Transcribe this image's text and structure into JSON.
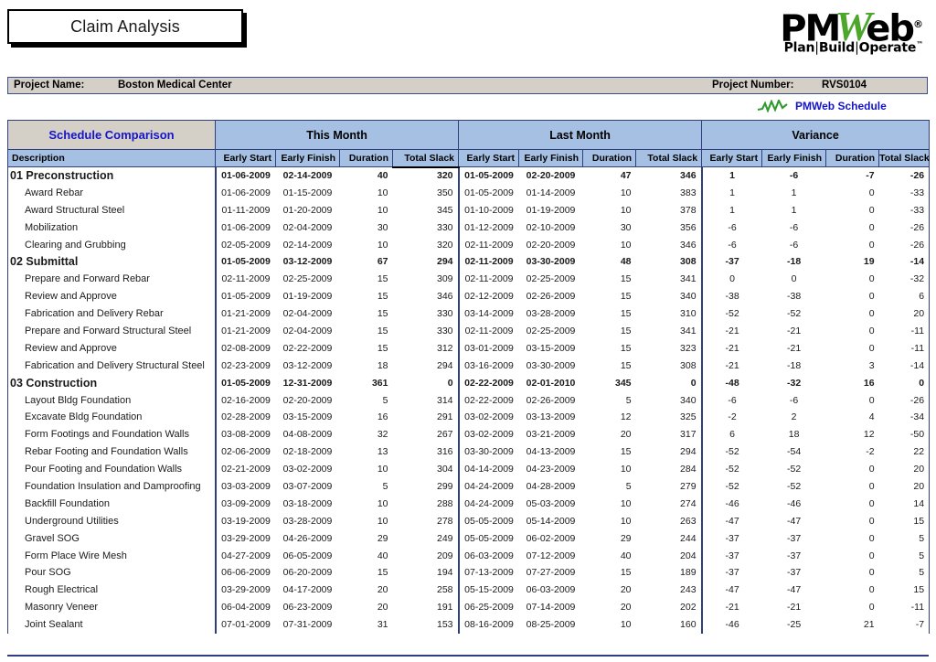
{
  "report": {
    "title": "Claim Analysis",
    "logo": {
      "part1": "PM",
      "part2": "W",
      "part3": "eb",
      "registered": "®",
      "tagline_plan": "Plan",
      "tagline_build": "Build",
      "tagline_operate": "Operate",
      "tagline_sep": "|",
      "tm": "™"
    },
    "project": {
      "name_label": "Project Name:",
      "name_value": "Boston Medical Center",
      "number_label": "Project Number:",
      "number_value": "RVS0104"
    },
    "legend": {
      "icon": "zigzag-schedule-icon",
      "label": "PMWeb Schedule"
    }
  },
  "colors": {
    "header_blue": "#A5C0E3",
    "header_gray": "#D4D0C8",
    "border_navy": "#2E3F7F",
    "link_blue": "#1414CC",
    "accent_green": "#4CA72C",
    "negative_red": "#E8221B"
  },
  "table": {
    "group_headers": [
      "Schedule Comparison",
      "This Month",
      "Last Month",
      "Variance"
    ],
    "columns": [
      "Description",
      "Early Start",
      "Early Finish",
      "Duration",
      "Total Slack",
      "Early Start",
      "Early Finish",
      "Duration",
      "Total Slack",
      "Early Start",
      "Early Finish",
      "Duration",
      "Total Slack"
    ],
    "rows": [
      {
        "level": 0,
        "desc": "01 Preconstruction",
        "tm": [
          "01-06-2009",
          "02-14-2009",
          "40",
          "320"
        ],
        "lm": [
          "01-05-2009",
          "02-20-2009",
          "47",
          "346"
        ],
        "va": [
          "1",
          "-6",
          "-7",
          "-26"
        ],
        "red": []
      },
      {
        "level": 1,
        "desc": "Award Rebar",
        "tm": [
          "01-06-2009",
          "01-15-2009",
          "10",
          "350"
        ],
        "lm": [
          "01-05-2009",
          "01-14-2009",
          "10",
          "383"
        ],
        "va": [
          "1",
          "1",
          "0",
          "-33"
        ],
        "red": []
      },
      {
        "level": 1,
        "desc": "Award Structural Steel",
        "tm": [
          "01-11-2009",
          "01-20-2009",
          "10",
          "345"
        ],
        "lm": [
          "01-10-2009",
          "01-19-2009",
          "10",
          "378"
        ],
        "va": [
          "1",
          "1",
          "0",
          "-33"
        ],
        "red": []
      },
      {
        "level": 1,
        "desc": "Mobilization",
        "tm": [
          "01-06-2009",
          "02-04-2009",
          "30",
          "330"
        ],
        "lm": [
          "01-12-2009",
          "02-10-2009",
          "30",
          "356"
        ],
        "va": [
          "-6",
          "-6",
          "0",
          "-26"
        ],
        "red": []
      },
      {
        "level": 1,
        "desc": "Clearing and Grubbing",
        "tm": [
          "02-05-2009",
          "02-14-2009",
          "10",
          "320"
        ],
        "lm": [
          "02-11-2009",
          "02-20-2009",
          "10",
          "346"
        ],
        "va": [
          "-6",
          "-6",
          "0",
          "-26"
        ],
        "red": []
      },
      {
        "level": 0,
        "desc": "02 Submittal",
        "tm": [
          "01-05-2009",
          "03-12-2009",
          "67",
          "294"
        ],
        "lm": [
          "02-11-2009",
          "03-30-2009",
          "48",
          "308"
        ],
        "va": [
          "-37",
          "-18",
          "19",
          "-14"
        ],
        "red": []
      },
      {
        "level": 1,
        "desc": "Prepare and Forward Rebar",
        "tm": [
          "02-11-2009",
          "02-25-2009",
          "15",
          "309"
        ],
        "lm": [
          "02-11-2009",
          "02-25-2009",
          "15",
          "341"
        ],
        "va": [
          "0",
          "0",
          "0",
          "-32"
        ],
        "red": []
      },
      {
        "level": 1,
        "desc": "Review and Approve",
        "tm": [
          "01-05-2009",
          "01-19-2009",
          "15",
          "346"
        ],
        "lm": [
          "02-12-2009",
          "02-26-2009",
          "15",
          "340"
        ],
        "va": [
          "-38",
          "-38",
          "0",
          "6"
        ],
        "red": []
      },
      {
        "level": 1,
        "desc": "Fabrication and Delivery Rebar",
        "tm": [
          "01-21-2009",
          "02-04-2009",
          "15",
          "330"
        ],
        "lm": [
          "03-14-2009",
          "03-28-2009",
          "15",
          "310"
        ],
        "va": [
          "-52",
          "-52",
          "0",
          "20"
        ],
        "red": []
      },
      {
        "level": 1,
        "desc": "Prepare and Forward Structural Steel",
        "tm": [
          "01-21-2009",
          "02-04-2009",
          "15",
          "330"
        ],
        "lm": [
          "02-11-2009",
          "02-25-2009",
          "15",
          "341"
        ],
        "va": [
          "-21",
          "-21",
          "0",
          "-11"
        ],
        "red": []
      },
      {
        "level": 1,
        "desc": "Review and Approve",
        "tm": [
          "02-08-2009",
          "02-22-2009",
          "15",
          "312"
        ],
        "lm": [
          "03-01-2009",
          "03-15-2009",
          "15",
          "323"
        ],
        "va": [
          "-21",
          "-21",
          "0",
          "-11"
        ],
        "red": []
      },
      {
        "level": 1,
        "desc": "Fabrication and Delivery Structural Steel",
        "tm": [
          "02-23-2009",
          "03-12-2009",
          "18",
          "294"
        ],
        "lm": [
          "03-16-2009",
          "03-30-2009",
          "15",
          "308"
        ],
        "va": [
          "-21",
          "-18",
          "3",
          "-14"
        ],
        "red": []
      },
      {
        "level": 0,
        "desc": "03 Construction",
        "tm": [
          "01-05-2009",
          "12-31-2009",
          "361",
          "0"
        ],
        "lm": [
          "02-22-2009",
          "02-01-2010",
          "345",
          "0"
        ],
        "va": [
          "-48",
          "-32",
          "16",
          "0"
        ],
        "red": [
          "tm3",
          "lm3",
          "va3"
        ]
      },
      {
        "level": 1,
        "desc": "Layout Bldg Foundation",
        "tm": [
          "02-16-2009",
          "02-20-2009",
          "5",
          "314"
        ],
        "lm": [
          "02-22-2009",
          "02-26-2009",
          "5",
          "340"
        ],
        "va": [
          "-6",
          "-6",
          "0",
          "-26"
        ],
        "red": []
      },
      {
        "level": 1,
        "desc": "Excavate Bldg Foundation",
        "tm": [
          "02-28-2009",
          "03-15-2009",
          "16",
          "291"
        ],
        "lm": [
          "03-02-2009",
          "03-13-2009",
          "12",
          "325"
        ],
        "va": [
          "-2",
          "2",
          "4",
          "-34"
        ],
        "red": []
      },
      {
        "level": 1,
        "desc": "Form Footings and Foundation Walls",
        "tm": [
          "03-08-2009",
          "04-08-2009",
          "32",
          "267"
        ],
        "lm": [
          "03-02-2009",
          "03-21-2009",
          "20",
          "317"
        ],
        "va": [
          "6",
          "18",
          "12",
          "-50"
        ],
        "red": []
      },
      {
        "level": 1,
        "desc": "Rebar Footing and Foundation Walls",
        "tm": [
          "02-06-2009",
          "02-18-2009",
          "13",
          "316"
        ],
        "lm": [
          "03-30-2009",
          "04-13-2009",
          "15",
          "294"
        ],
        "va": [
          "-52",
          "-54",
          "-2",
          "22"
        ],
        "red": []
      },
      {
        "level": 1,
        "desc": "Pour Footing and Foundation Walls",
        "tm": [
          "02-21-2009",
          "03-02-2009",
          "10",
          "304"
        ],
        "lm": [
          "04-14-2009",
          "04-23-2009",
          "10",
          "284"
        ],
        "va": [
          "-52",
          "-52",
          "0",
          "20"
        ],
        "red": []
      },
      {
        "level": 1,
        "desc": "Foundation Insulation and Damproofing",
        "tm": [
          "03-03-2009",
          "03-07-2009",
          "5",
          "299"
        ],
        "lm": [
          "04-24-2009",
          "04-28-2009",
          "5",
          "279"
        ],
        "va": [
          "-52",
          "-52",
          "0",
          "20"
        ],
        "red": []
      },
      {
        "level": 1,
        "desc": "Backfill Foundation",
        "tm": [
          "03-09-2009",
          "03-18-2009",
          "10",
          "288"
        ],
        "lm": [
          "04-24-2009",
          "05-03-2009",
          "10",
          "274"
        ],
        "va": [
          "-46",
          "-46",
          "0",
          "14"
        ],
        "red": []
      },
      {
        "level": 1,
        "desc": "Underground Utilities",
        "tm": [
          "03-19-2009",
          "03-28-2009",
          "10",
          "278"
        ],
        "lm": [
          "05-05-2009",
          "05-14-2009",
          "10",
          "263"
        ],
        "va": [
          "-47",
          "-47",
          "0",
          "15"
        ],
        "red": []
      },
      {
        "level": 1,
        "desc": "Gravel SOG",
        "tm": [
          "03-29-2009",
          "04-26-2009",
          "29",
          "249"
        ],
        "lm": [
          "05-05-2009",
          "06-02-2009",
          "29",
          "244"
        ],
        "va": [
          "-37",
          "-37",
          "0",
          "5"
        ],
        "red": []
      },
      {
        "level": 1,
        "desc": "Form Place Wire Mesh",
        "tm": [
          "04-27-2009",
          "06-05-2009",
          "40",
          "209"
        ],
        "lm": [
          "06-03-2009",
          "07-12-2009",
          "40",
          "204"
        ],
        "va": [
          "-37",
          "-37",
          "0",
          "5"
        ],
        "red": []
      },
      {
        "level": 1,
        "desc": "Pour SOG",
        "tm": [
          "06-06-2009",
          "06-20-2009",
          "15",
          "194"
        ],
        "lm": [
          "07-13-2009",
          "07-27-2009",
          "15",
          "189"
        ],
        "va": [
          "-37",
          "-37",
          "0",
          "5"
        ],
        "red": []
      },
      {
        "level": 1,
        "desc": "Rough Electrical",
        "tm": [
          "03-29-2009",
          "04-17-2009",
          "20",
          "258"
        ],
        "lm": [
          "05-15-2009",
          "06-03-2009",
          "20",
          "243"
        ],
        "va": [
          "-47",
          "-47",
          "0",
          "15"
        ],
        "red": []
      },
      {
        "level": 1,
        "desc": "Masonry Veneer",
        "tm": [
          "06-04-2009",
          "06-23-2009",
          "20",
          "191"
        ],
        "lm": [
          "06-25-2009",
          "07-14-2009",
          "20",
          "202"
        ],
        "va": [
          "-21",
          "-21",
          "0",
          "-11"
        ],
        "red": []
      },
      {
        "level": 1,
        "desc": "Joint Sealant",
        "tm": [
          "07-01-2009",
          "07-31-2009",
          "31",
          "153"
        ],
        "lm": [
          "08-16-2009",
          "08-25-2009",
          "10",
          "160"
        ],
        "va": [
          "-46",
          "-25",
          "21",
          "-7"
        ],
        "red": []
      }
    ]
  }
}
